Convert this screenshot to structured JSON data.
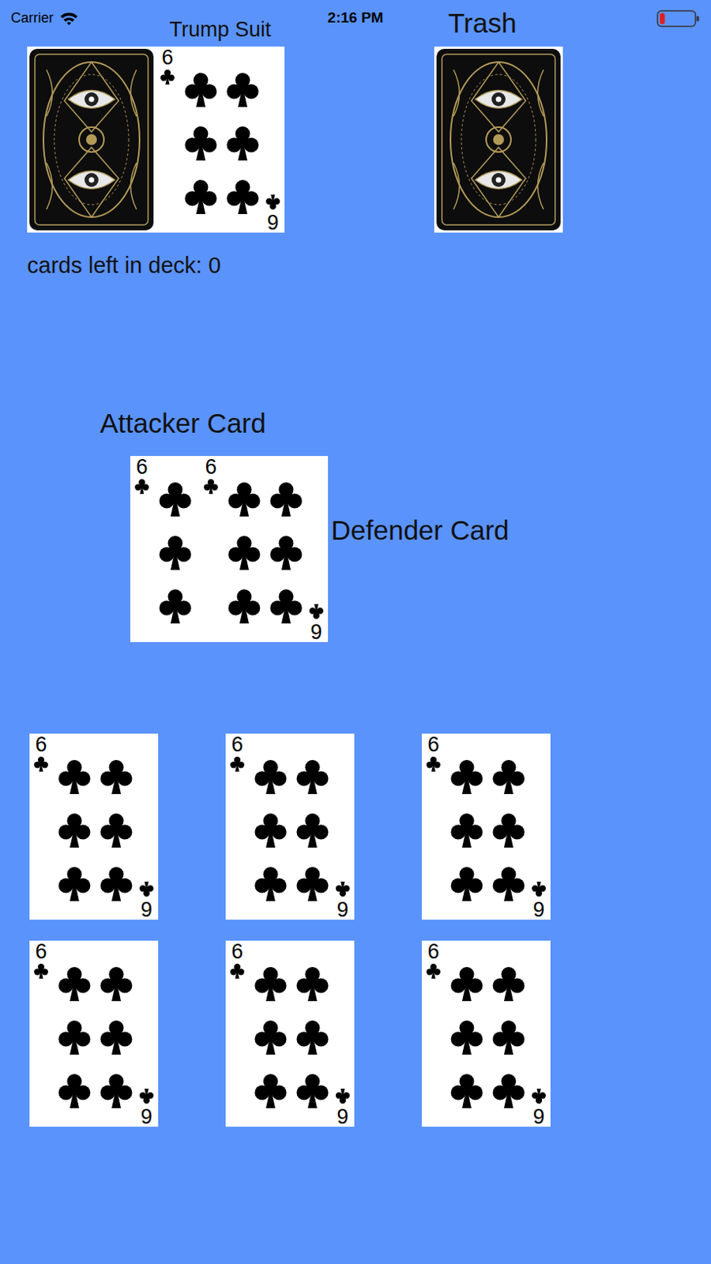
{
  "status_bar": {
    "carrier": "Carrier",
    "time": "2:16 PM",
    "battery_level": 0.15,
    "battery_low": true
  },
  "deck": {
    "card": {
      "rank": "6",
      "suit": "clubs",
      "face_up": false
    },
    "count_text": "cards left in deck: 0"
  },
  "trump": {
    "label": "Trump Suit",
    "card": {
      "rank": "6",
      "suit": "clubs",
      "face_up": true
    }
  },
  "trash": {
    "label": "Trash",
    "card": {
      "rank": "6",
      "suit": "clubs",
      "face_up": false
    }
  },
  "table": {
    "attacker_label": "Attacker Card",
    "defender_label": "Defender Card",
    "attacker_card": {
      "rank": "6",
      "suit": "clubs",
      "face_up": true
    },
    "defender_card": {
      "rank": "6",
      "suit": "clubs",
      "face_up": true
    }
  },
  "hand": [
    {
      "rank": "6",
      "suit": "clubs",
      "face_up": true
    },
    {
      "rank": "6",
      "suit": "clubs",
      "face_up": true
    },
    {
      "rank": "6",
      "suit": "clubs",
      "face_up": true
    },
    {
      "rank": "6",
      "suit": "clubs",
      "face_up": true
    },
    {
      "rank": "6",
      "suit": "clubs",
      "face_up": true
    },
    {
      "rank": "6",
      "suit": "clubs",
      "face_up": true
    }
  ]
}
